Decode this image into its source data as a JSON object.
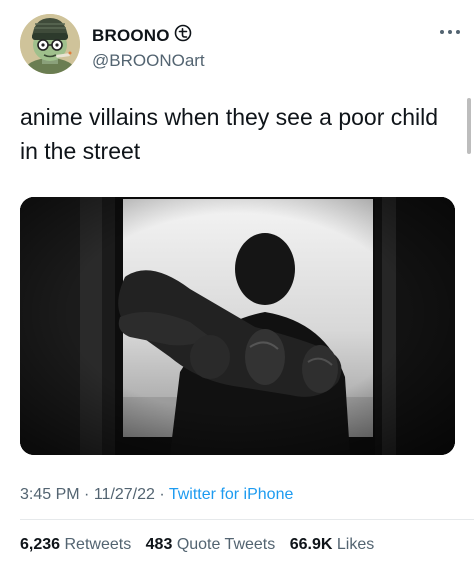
{
  "author": {
    "display_name": "BROONO",
    "handle": "@BROONOart",
    "avatar_icon": "cartoon-character-avatar",
    "badge_icon": "circled-symbol-icon"
  },
  "tweet": {
    "text": "anime villains when they see a poor child in the street",
    "media_icon": "photo-silhouette-reaching-hand",
    "time": "3:45 PM",
    "date": "11/27/22",
    "separator": "·",
    "source": "Twitter for iPhone"
  },
  "stats": {
    "retweets_count": "6,236",
    "retweets_label": "Retweets",
    "quotes_count": "483",
    "quotes_label": "Quote Tweets",
    "likes_count": "66.9K",
    "likes_label": "Likes"
  },
  "colors": {
    "link": "#1d9bf0",
    "secondary_text": "#536471",
    "primary_text": "#0f1419"
  }
}
